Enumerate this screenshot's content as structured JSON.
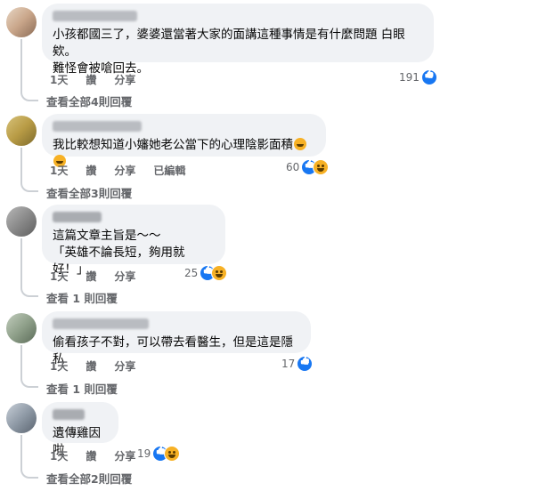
{
  "comments": [
    {
      "text": "小孩都國三了，婆婆還當著大家的面講這種事情是有什麼問題 白眼欸。\n難怪會被嗆回去。",
      "actions": [
        "1天",
        "讚",
        "分享"
      ],
      "count": "191",
      "view_replies": "查看全部4則回覆"
    },
    {
      "text": "我比較想知道小嬸她老公當下的心理陰影面積",
      "actions": [
        "1天",
        "讚",
        "分享",
        "已編輯"
      ],
      "count": "60",
      "view_replies": "查看全部3則回覆"
    },
    {
      "text": "這篇文章主旨是～～\n「英雄不論長短，夠用就好！」",
      "actions": [
        "1天",
        "讚",
        "分享"
      ],
      "count": "25",
      "view_replies": "查看 1 則回覆"
    },
    {
      "text": "偷看孩子不對，可以帶去看醫生，但是這是隱私",
      "actions": [
        "1天",
        "讚",
        "分享"
      ],
      "count": "17",
      "view_replies": "查看 1 則回覆"
    },
    {
      "text": "遺傳雞因啦",
      "actions": [
        "1天",
        "讚",
        "分享"
      ],
      "count": "19",
      "view_replies": "查看全部2則回覆"
    }
  ],
  "reaction_icons": {
    "like": "like-icon",
    "haha": "haha-icon"
  },
  "colors": {
    "bubble": "#f0f2f5",
    "like": "#1877f2",
    "haha": "#f7b125",
    "meta_text": "#65676b"
  }
}
